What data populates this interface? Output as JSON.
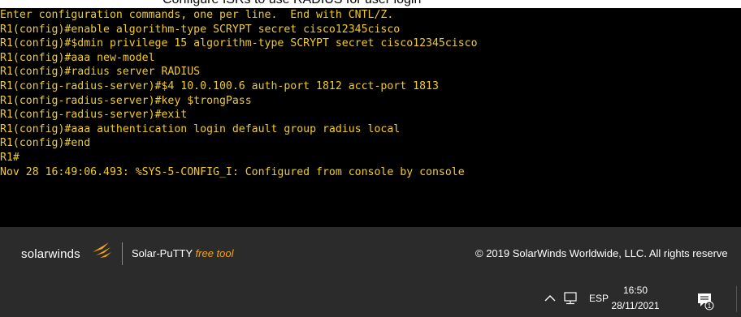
{
  "caption": {
    "text": "Configure ISRs to use RADIUS for user login"
  },
  "terminal": {
    "text_color": "#f2cc24",
    "background": "#000000",
    "lines": [
      "Enter configuration commands, one per line.  End with CNTL/Z.",
      "R1(config)#enable algorithm-type SCRYPT secret cisco12345cisco",
      "R1(config)#$dmin privilege 15 algorithm-type SCRYPT secret cisco12345cisco",
      "R1(config)#aaa new-model",
      "R1(config)#radius server RADIUS",
      "R1(config-radius-server)#$4 10.0.100.6 auth-port 1812 acct-port 1813",
      "R1(config-radius-server)#key $trongPass",
      "R1(config-radius-server)#exit",
      "R1(config)#aaa authentication login default group radius local",
      "R1(config)#end",
      "R1#",
      "Nov 28 16:49:06.493: %SYS-5-CONFIG_I: Configured from console by console",
      ""
    ]
  },
  "footer": {
    "brand": "solarwinds",
    "product": "Solar-PuTTY",
    "product_tag": "free tool",
    "copyright": "© 2019 SolarWinds Worldwide, LLC. All rights reserve",
    "accent_color": "#f5a31a"
  },
  "taskbar": {
    "icons": [
      "chevron-up-icon",
      "network-icon",
      "notification-icon"
    ],
    "language": "ESP",
    "time": "16:50",
    "date": "28/11/2021",
    "notification_count": "1"
  }
}
